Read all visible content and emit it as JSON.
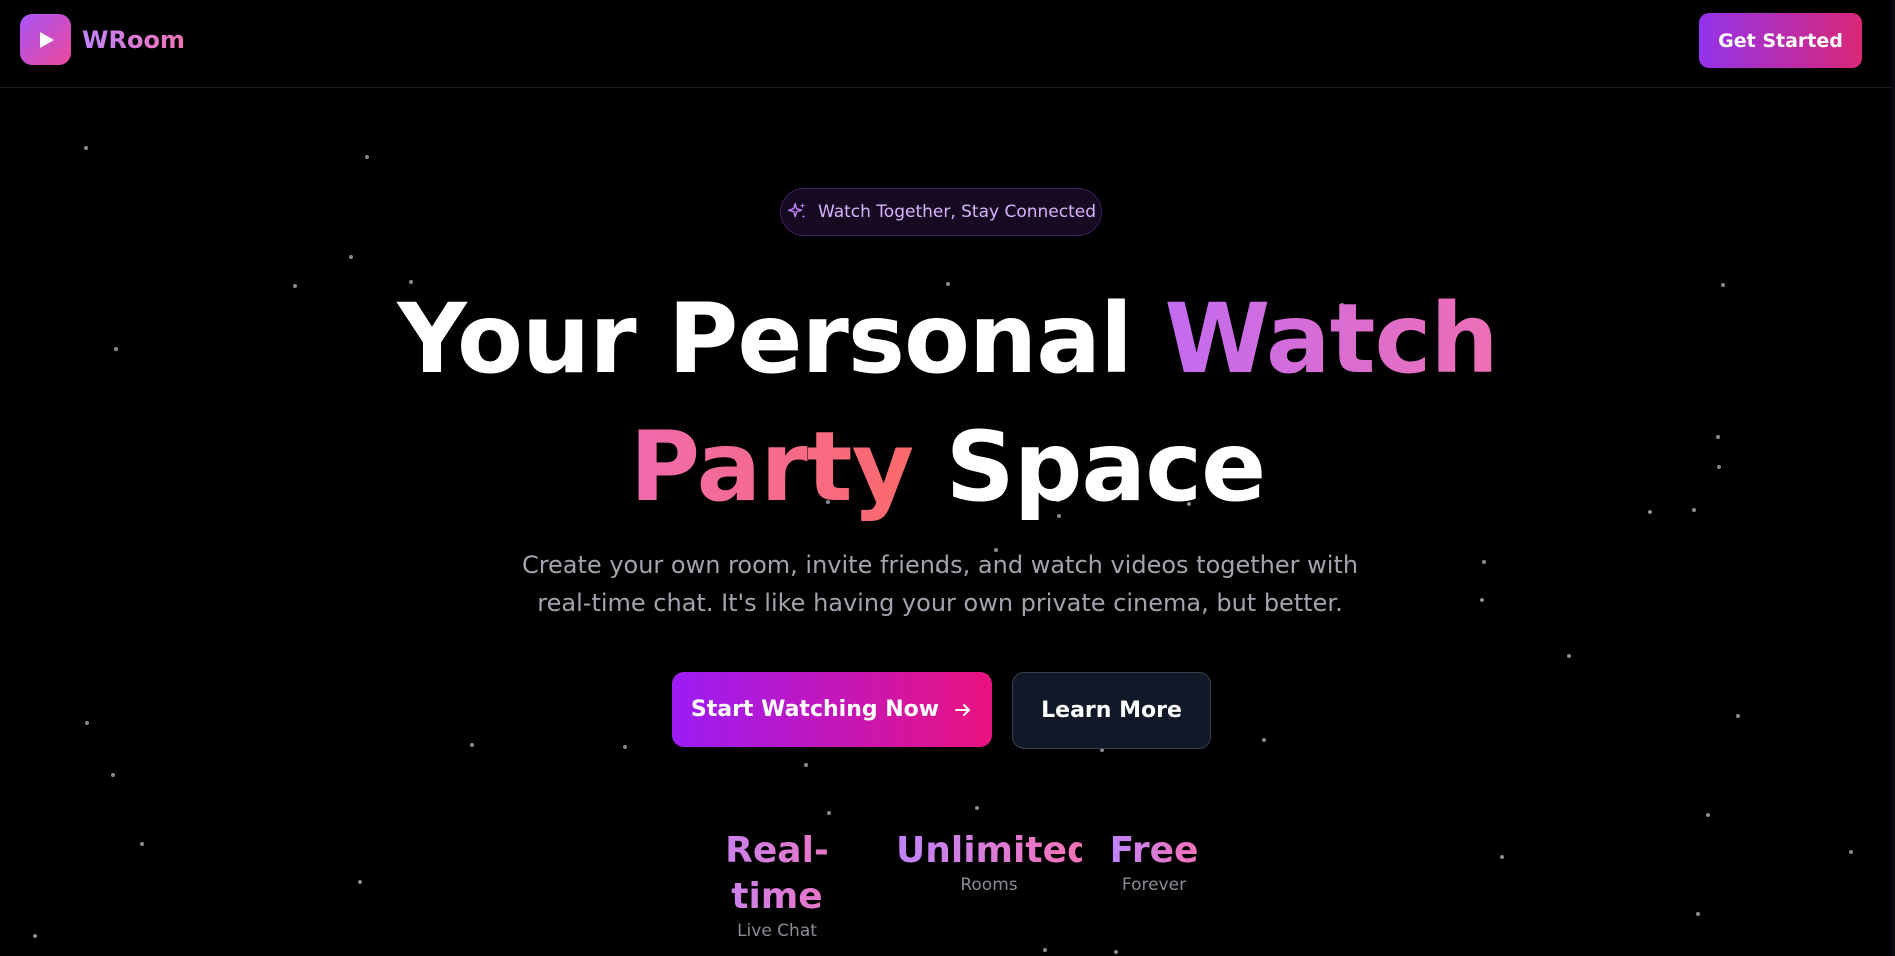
{
  "header": {
    "brand_name": "WRoom",
    "brand_icon": "play-icon",
    "cta_label": "Get Started"
  },
  "hero": {
    "badge_icon": "sparkles-icon",
    "badge_text": "Watch Together, Stay Connected",
    "headline_part1": "Your Personal ",
    "headline_highlight1": "Watch",
    "headline_highlight2": "Party",
    "headline_part2": " Space",
    "subtitle": "Create your own room, invite friends, and watch videos together with real-time chat. It's like having your own private cinema, but better.",
    "primary_button": "Start Watching Now",
    "primary_button_icon": "arrow-right-icon",
    "secondary_button": "Learn More"
  },
  "stats": [
    {
      "value": "Real-time",
      "label": "Live Chat"
    },
    {
      "value": "Unlimited",
      "label": "Rooms"
    },
    {
      "value": "Free",
      "label": "Forever"
    }
  ],
  "colors": {
    "background": "#000000",
    "accent_purple": "#9333ea",
    "accent_pink": "#db2777",
    "gradient_text_start": "#c084fc",
    "gradient_text_end": "#f472b6"
  }
}
